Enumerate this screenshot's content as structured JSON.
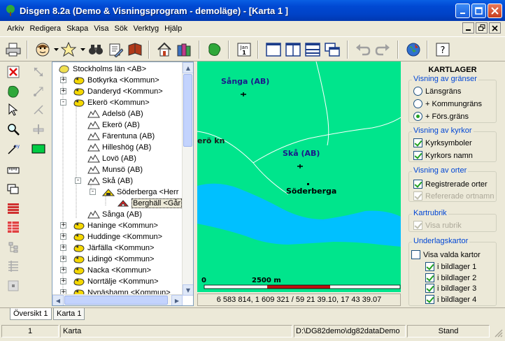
{
  "window": {
    "title": "Disgen 8.2a (Demo & Visningsprogram - demoläge) - [Karta 1 ]"
  },
  "menu": [
    "Arkiv",
    "Redigera",
    "Skapa",
    "Visa",
    "Sök",
    "Verktyg",
    "Hjälp"
  ],
  "toolbar": {
    "calendar_text": "Jan"
  },
  "tree": {
    "rows": [
      {
        "label": "Stockholms län <AB>",
        "icon": "region-icon",
        "expander": ""
      },
      {
        "label": "Botkyrka <Kommun>",
        "icon": "municipality-icon",
        "expander": "+"
      },
      {
        "label": "Danderyd <Kommun>",
        "icon": "municipality-icon",
        "expander": "+"
      },
      {
        "label": "Ekerö <Kommun>",
        "icon": "municipality-icon",
        "expander": "-"
      },
      {
        "label": "Adelsö (AB)",
        "icon": "parish-icon",
        "expander": ""
      },
      {
        "label": "Ekerö (AB)",
        "icon": "parish-icon",
        "expander": ""
      },
      {
        "label": "Färentuna (AB)",
        "icon": "parish-icon",
        "expander": ""
      },
      {
        "label": "Hilleshög (AB)",
        "icon": "parish-icon",
        "expander": ""
      },
      {
        "label": "Lovö (AB)",
        "icon": "parish-icon",
        "expander": ""
      },
      {
        "label": "Munsö (AB)",
        "icon": "parish-icon",
        "expander": ""
      },
      {
        "label": "Skå (AB)",
        "icon": "parish-icon",
        "expander": "-"
      },
      {
        "label": "Söderberga <Herr",
        "icon": "manor-icon",
        "expander": "-"
      },
      {
        "label": "Berghäll <Går",
        "icon": "farm-icon",
        "expander": ""
      },
      {
        "label": "Sånga (AB)",
        "icon": "parish-icon",
        "expander": ""
      },
      {
        "label": "Haninge <Kommun>",
        "icon": "municipality-icon",
        "expander": "+"
      },
      {
        "label": "Huddinge <Kommun>",
        "icon": "municipality-icon",
        "expander": "+"
      },
      {
        "label": "Järfälla <Kommun>",
        "icon": "municipality-icon",
        "expander": "+"
      },
      {
        "label": "Lidingö <Kommun>",
        "icon": "municipality-icon",
        "expander": "+"
      },
      {
        "label": "Nacka <Kommun>",
        "icon": "municipality-icon",
        "expander": "+"
      },
      {
        "label": "Norrtälje <Kommun>",
        "icon": "municipality-icon",
        "expander": "+"
      },
      {
        "label": "Nynäshamn <Kommun>",
        "icon": "municipality-icon",
        "expander": "+"
      }
    ]
  },
  "map": {
    "labels": {
      "sanga": "Sånga (AB)",
      "ekero": "erö kn",
      "ska": "Skå (AB)",
      "soderberga": "Söderberga"
    },
    "scale": {
      "zero": "0",
      "distance": "2500 m"
    },
    "coordinates": "6 583 814, 1 609 321 / 59 21 39.10, 17 43 39.07",
    "colors": {
      "land": "#00e58c",
      "water": "#00c0ff"
    }
  },
  "kartlager": {
    "title": "KARTLAGER",
    "granser": {
      "label": "Visning av gränser",
      "options": [
        "Länsgräns",
        "+ Kommungräns",
        "+ Förs.gräns"
      ],
      "selected": 2
    },
    "kyrkor": {
      "label": "Visning av kyrkor",
      "items": [
        {
          "label": "Kyrksymboler",
          "checked": true,
          "enabled": true
        },
        {
          "label": "Kyrkors namn",
          "checked": true,
          "enabled": true
        }
      ]
    },
    "orter": {
      "label": "Visning av orter",
      "items": [
        {
          "label": "Registrerade orter",
          "checked": true,
          "enabled": true
        },
        {
          "label": "Refererade ortnamn",
          "checked": true,
          "enabled": false
        }
      ]
    },
    "kartrubrik": {
      "label": "Kartrubrik",
      "items": [
        {
          "label": "Visa rubrik",
          "checked": true,
          "enabled": false
        }
      ]
    },
    "underlag": {
      "label": "Underlagskartor",
      "show_selected": {
        "label": "Visa valda kartor",
        "checked": false
      },
      "layers": [
        {
          "label": "i bildlager 1",
          "checked": true
        },
        {
          "label": "i bildlager 2",
          "checked": true
        },
        {
          "label": "i bildlager 3",
          "checked": true
        },
        {
          "label": "i bildlager 4",
          "checked": true
        }
      ]
    }
  },
  "tabs": [
    "Översikt 1",
    "Karta 1"
  ],
  "statusbar": {
    "number": "1",
    "view": "Karta",
    "path": "D:\\DG82demo\\dg82dataDemo",
    "mode": "Stand"
  }
}
